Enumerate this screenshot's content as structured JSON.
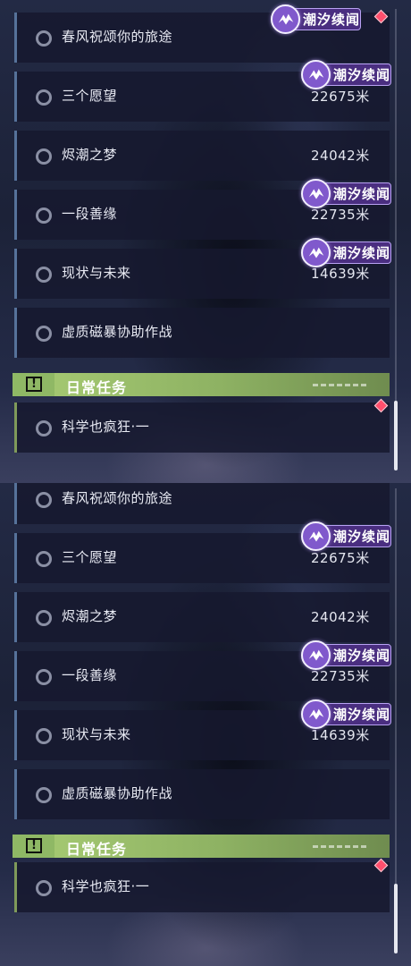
{
  "top": {
    "quests": [
      {
        "title": "春风祝颂你的旅途",
        "distance": "",
        "badge": "潮汐续闻"
      },
      {
        "title": "三个愿望",
        "distance": "22675米",
        "badge": "潮汐续闻"
      },
      {
        "title": "烬潮之梦",
        "distance": "24042米",
        "badge": ""
      },
      {
        "title": "一段善缘",
        "distance": "22735米",
        "badge": "潮汐续闻"
      },
      {
        "title": "现状与未来",
        "distance": "14639米",
        "badge": "潮汐续闻"
      },
      {
        "title": "虚质磁暴协助作战",
        "distance": "",
        "badge": ""
      }
    ],
    "daily_header": {
      "label": "日常任务",
      "warn_symbol": "!"
    },
    "daily_quest": {
      "title": "科学也疯狂·一"
    }
  },
  "bottom": {
    "quests": [
      {
        "title": "春风祝颂你的旅途",
        "distance": "",
        "badge": ""
      },
      {
        "title": "三个愿望",
        "distance": "22675米",
        "badge": "潮汐续闻"
      },
      {
        "title": "烬潮之梦",
        "distance": "24042米",
        "badge": ""
      },
      {
        "title": "一段善缘",
        "distance": "22735米",
        "badge": "潮汐续闻"
      },
      {
        "title": "现状与未来",
        "distance": "14639米",
        "badge": "潮汐续闻"
      },
      {
        "title": "虚质磁暴协助作战",
        "distance": "",
        "badge": ""
      }
    ],
    "daily_header": {
      "label": "日常任务",
      "warn_symbol": "!"
    },
    "daily_quest": {
      "title": "科学也疯狂·一"
    }
  },
  "colors": {
    "badge_purple": "#4a2e80",
    "daily_green": "#a8cc74",
    "alert_red": "#ff4f6d",
    "row_bar_blue": "#56729a"
  },
  "icons": [
    "radio-circle-icon",
    "tidal-emblem-icon",
    "alert-diamond-icon",
    "warning-icon"
  ]
}
